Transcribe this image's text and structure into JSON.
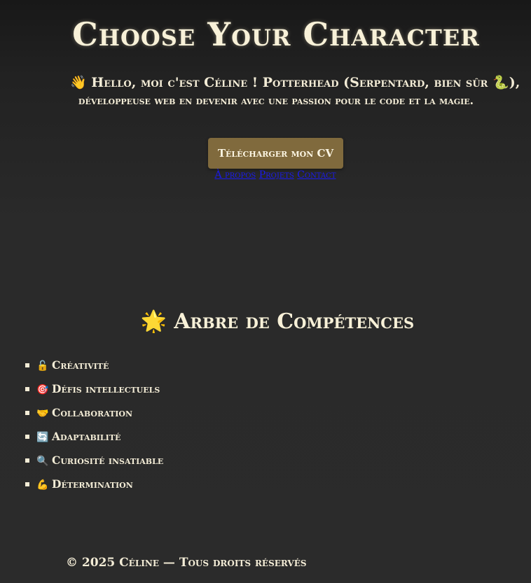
{
  "hero": {
    "title": "Choose Your Character",
    "intro_line1": "👋 Hello, moi c'est Céline ! Potterhead (Serpentard, bien sûr 🐍),",
    "intro_line2": "développeuse web en devenir avec une passion pour le code et la magie.",
    "cv_button": "Télécharger mon CV"
  },
  "nav": {
    "items": [
      {
        "label": "À propos"
      },
      {
        "label": "Projets"
      },
      {
        "label": "Contact"
      }
    ],
    "link_color": "#1a1aee"
  },
  "skills": {
    "title_icon": "🌟",
    "title": "Arbre de Compétences",
    "items": [
      {
        "icon": "🔓",
        "label": "Créativité"
      },
      {
        "icon": "🎯",
        "label": "Défis intellectuels"
      },
      {
        "icon": "🤝",
        "label": "Collaboration"
      },
      {
        "icon": "🔄",
        "label": "Adaptabilité"
      },
      {
        "icon": "🔍",
        "label": "Curiosité insatiable"
      },
      {
        "icon": "💪",
        "label": "Détermination"
      }
    ]
  },
  "footer": {
    "text": "© 2025 Céline — Tous droits réservés"
  },
  "colors": {
    "background": "#2b2b2b",
    "text": "#f3ecd6",
    "button": "#806a3d"
  }
}
